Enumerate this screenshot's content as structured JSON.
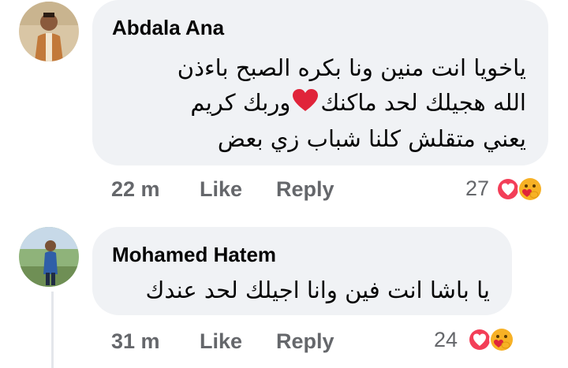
{
  "comments": [
    {
      "author": "Abdala Ana",
      "lines": [
        "ياخويا انت منين ونا بكره الصبح باءذن",
        "الله هجيلك لحد ماكنك",
        "وربك كريم",
        "يعني متقلش كلنا شباب زي بعض"
      ],
      "time": "22 m",
      "like_label": "Like",
      "reply_label": "Reply",
      "reaction_count": "27",
      "reaction_icons": [
        "love-icon",
        "care-icon"
      ]
    },
    {
      "author": "Mohamed Hatem",
      "lines": [
        "يا باشا انت فين وانا اجيلك لحد عندك"
      ],
      "time": "31 m",
      "like_label": "Like",
      "reply_label": "Reply",
      "reaction_count": "24",
      "reaction_icons": [
        "love-icon",
        "care-icon"
      ]
    }
  ],
  "colors": {
    "bubble": "#f0f2f5",
    "meta_text": "#65676b",
    "love": "#f33e58",
    "care": "#f7b125"
  }
}
